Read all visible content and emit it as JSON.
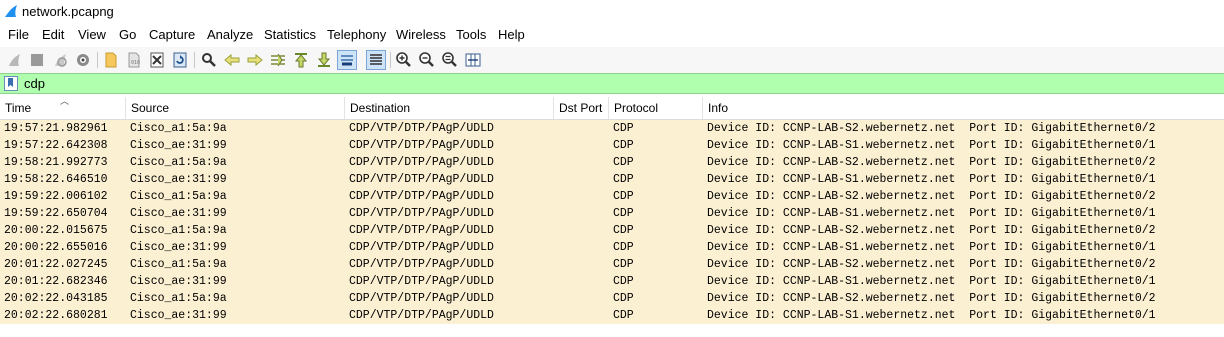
{
  "window": {
    "title": "network.pcapng",
    "icon": "shark-fin-icon",
    "accent": "#1f8ff0"
  },
  "menu": [
    "File",
    "Edit",
    "View",
    "Go",
    "Capture",
    "Analyze",
    "Statistics",
    "Telephony",
    "Wireless",
    "Tools",
    "Help"
  ],
  "toolbar": {
    "buttons": [
      "start-capture-icon",
      "stop-capture-icon",
      "restart-capture-icon",
      "capture-options-icon",
      "open-file-icon",
      "save-file-icon",
      "close-file-icon",
      "reload-file-icon",
      "find-packet-icon",
      "go-back-icon",
      "go-forward-icon",
      "go-to-packet-icon",
      "go-first-icon",
      "go-last-icon",
      "autoscroll-icon",
      "colorize-icon",
      "zoom-in-icon",
      "zoom-out-icon",
      "normal-size-icon",
      "resize-columns-icon"
    ]
  },
  "filter": {
    "value": "cdp",
    "background": "#afffaf"
  },
  "packet_list": {
    "columns": [
      "Time",
      "Source",
      "Destination",
      "Dst Port",
      "Protocol",
      "Info"
    ],
    "row_color": "#fcf0d2",
    "rows": [
      [
        "19:57:21.982961",
        "Cisco_a1:5a:9a",
        "CDP/VTP/DTP/PAgP/UDLD",
        "",
        "CDP",
        "Device ID: CCNP-LAB-S2.webernetz.net  Port ID: GigabitEthernet0/2"
      ],
      [
        "19:57:22.642308",
        "Cisco_ae:31:99",
        "CDP/VTP/DTP/PAgP/UDLD",
        "",
        "CDP",
        "Device ID: CCNP-LAB-S1.webernetz.net  Port ID: GigabitEthernet0/1"
      ],
      [
        "19:58:21.992773",
        "Cisco_a1:5a:9a",
        "CDP/VTP/DTP/PAgP/UDLD",
        "",
        "CDP",
        "Device ID: CCNP-LAB-S2.webernetz.net  Port ID: GigabitEthernet0/2"
      ],
      [
        "19:58:22.646510",
        "Cisco_ae:31:99",
        "CDP/VTP/DTP/PAgP/UDLD",
        "",
        "CDP",
        "Device ID: CCNP-LAB-S1.webernetz.net  Port ID: GigabitEthernet0/1"
      ],
      [
        "19:59:22.006102",
        "Cisco_a1:5a:9a",
        "CDP/VTP/DTP/PAgP/UDLD",
        "",
        "CDP",
        "Device ID: CCNP-LAB-S2.webernetz.net  Port ID: GigabitEthernet0/2"
      ],
      [
        "19:59:22.650704",
        "Cisco_ae:31:99",
        "CDP/VTP/DTP/PAgP/UDLD",
        "",
        "CDP",
        "Device ID: CCNP-LAB-S1.webernetz.net  Port ID: GigabitEthernet0/1"
      ],
      [
        "20:00:22.015675",
        "Cisco_a1:5a:9a",
        "CDP/VTP/DTP/PAgP/UDLD",
        "",
        "CDP",
        "Device ID: CCNP-LAB-S2.webernetz.net  Port ID: GigabitEthernet0/2"
      ],
      [
        "20:00:22.655016",
        "Cisco_ae:31:99",
        "CDP/VTP/DTP/PAgP/UDLD",
        "",
        "CDP",
        "Device ID: CCNP-LAB-S1.webernetz.net  Port ID: GigabitEthernet0/1"
      ],
      [
        "20:01:22.027245",
        "Cisco_a1:5a:9a",
        "CDP/VTP/DTP/PAgP/UDLD",
        "",
        "CDP",
        "Device ID: CCNP-LAB-S2.webernetz.net  Port ID: GigabitEthernet0/2"
      ],
      [
        "20:01:22.682346",
        "Cisco_ae:31:99",
        "CDP/VTP/DTP/PAgP/UDLD",
        "",
        "CDP",
        "Device ID: CCNP-LAB-S1.webernetz.net  Port ID: GigabitEthernet0/1"
      ],
      [
        "20:02:22.043185",
        "Cisco_a1:5a:9a",
        "CDP/VTP/DTP/PAgP/UDLD",
        "",
        "CDP",
        "Device ID: CCNP-LAB-S2.webernetz.net  Port ID: GigabitEthernet0/2"
      ],
      [
        "20:02:22.680281",
        "Cisco_ae:31:99",
        "CDP/VTP/DTP/PAgP/UDLD",
        "",
        "CDP",
        "Device ID: CCNP-LAB-S1.webernetz.net  Port ID: GigabitEthernet0/1"
      ]
    ]
  }
}
